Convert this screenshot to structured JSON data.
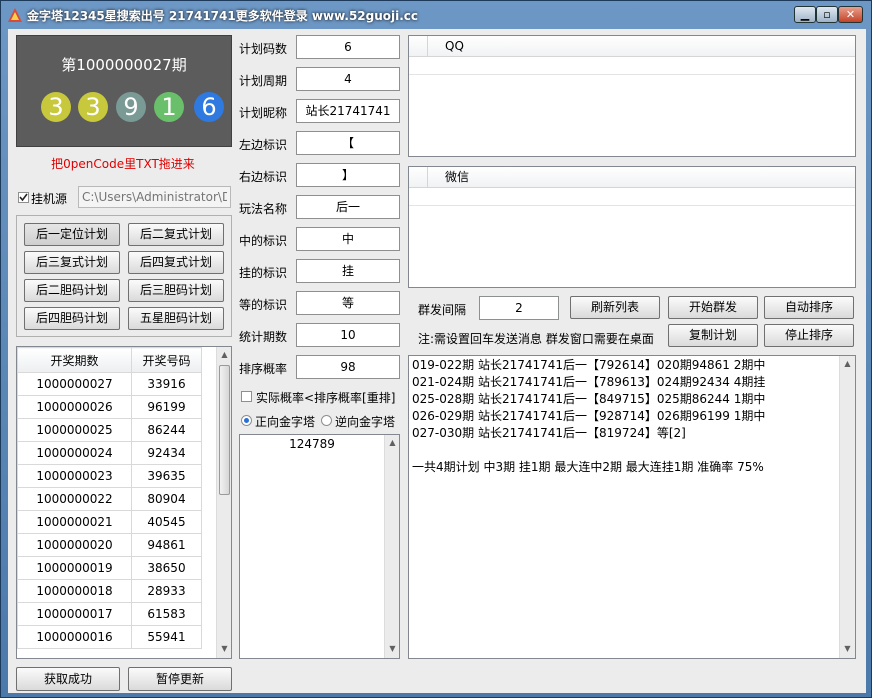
{
  "window": {
    "title": "金字塔12345星搜索出号 21741741更多软件登录 www.52guoji.cc"
  },
  "display": {
    "period": "第1000000027期",
    "balls": [
      {
        "value": "3",
        "color": "#c8c83c"
      },
      {
        "value": "3",
        "color": "#c8c83c"
      },
      {
        "value": "9",
        "color": "#7a9a96"
      },
      {
        "value": "1",
        "color": "#6ac06a"
      },
      {
        "value": "6",
        "color": "#2f7ae0"
      }
    ],
    "drag_hint": "把0penCode里TXT拖进来"
  },
  "source": {
    "label": "挂机源",
    "path_placeholder": "C:\\Users\\Administrator\\D"
  },
  "plan_buttons": [
    "后一定位计划",
    "后二复式计划",
    "后三复式计划",
    "后四复式计划",
    "后二胆码计划",
    "后三胆码计划",
    "后四胆码计划",
    "五星胆码计划"
  ],
  "history": {
    "headers": [
      "开奖期数",
      "开奖号码"
    ],
    "rows": [
      [
        "1000000027",
        "33916"
      ],
      [
        "1000000026",
        "96199"
      ],
      [
        "1000000025",
        "86244"
      ],
      [
        "1000000024",
        "92434"
      ],
      [
        "1000000023",
        "39635"
      ],
      [
        "1000000022",
        "80904"
      ],
      [
        "1000000021",
        "40545"
      ],
      [
        "1000000020",
        "94861"
      ],
      [
        "1000000019",
        "38650"
      ],
      [
        "1000000018",
        "28933"
      ],
      [
        "1000000017",
        "61583"
      ],
      [
        "1000000016",
        "55941"
      ]
    ]
  },
  "fields": [
    {
      "label": "计划码数",
      "value": "6"
    },
    {
      "label": "计划周期",
      "value": "4"
    },
    {
      "label": "计划昵称",
      "value": "站长21741741"
    },
    {
      "label": "左边标识",
      "value": "【"
    },
    {
      "label": "右边标识",
      "value": "】"
    },
    {
      "label": "玩法名称",
      "value": "后一"
    },
    {
      "label": "中的标识",
      "value": "中"
    },
    {
      "label": "挂的标识",
      "value": "挂"
    },
    {
      "label": "等的标识",
      "value": "等"
    },
    {
      "label": "统计期数",
      "value": "10"
    },
    {
      "label": "排序概率",
      "value": "98"
    }
  ],
  "options": {
    "actual_prob": "实际概率<排序概率[重排]",
    "forward": "正向金字塔",
    "reverse": "逆向金字塔"
  },
  "pyramid_list": [
    "124789"
  ],
  "qq_header": "QQ",
  "wechat_header": "微信",
  "group": {
    "interval_label": "群发间隔",
    "interval_value": "2",
    "refresh": "刷新列表",
    "start": "开始群发",
    "auto_sort": "自动排序",
    "note": "注:需设置回车发送消息 群发窗口需要在桌面",
    "copy": "复制计划",
    "stop_sort": "停止排序"
  },
  "log_lines": [
    "019-022期 站长21741741后一【792614】020期94861 2期中",
    "021-024期 站长21741741后一【789613】024期92434 4期挂",
    "025-028期 站长21741741后一【849715】025期86244 1期中",
    "026-029期 站长21741741后一【928714】026期96199 1期中",
    "027-030期 站长21741741后一【819724】等[2]",
    "",
    "一共4期计划 中3期 挂1期 最大连中2期 最大连挂1期 准确率 75%"
  ],
  "bottom": {
    "status": "获取成功",
    "pause": "暂停更新"
  }
}
